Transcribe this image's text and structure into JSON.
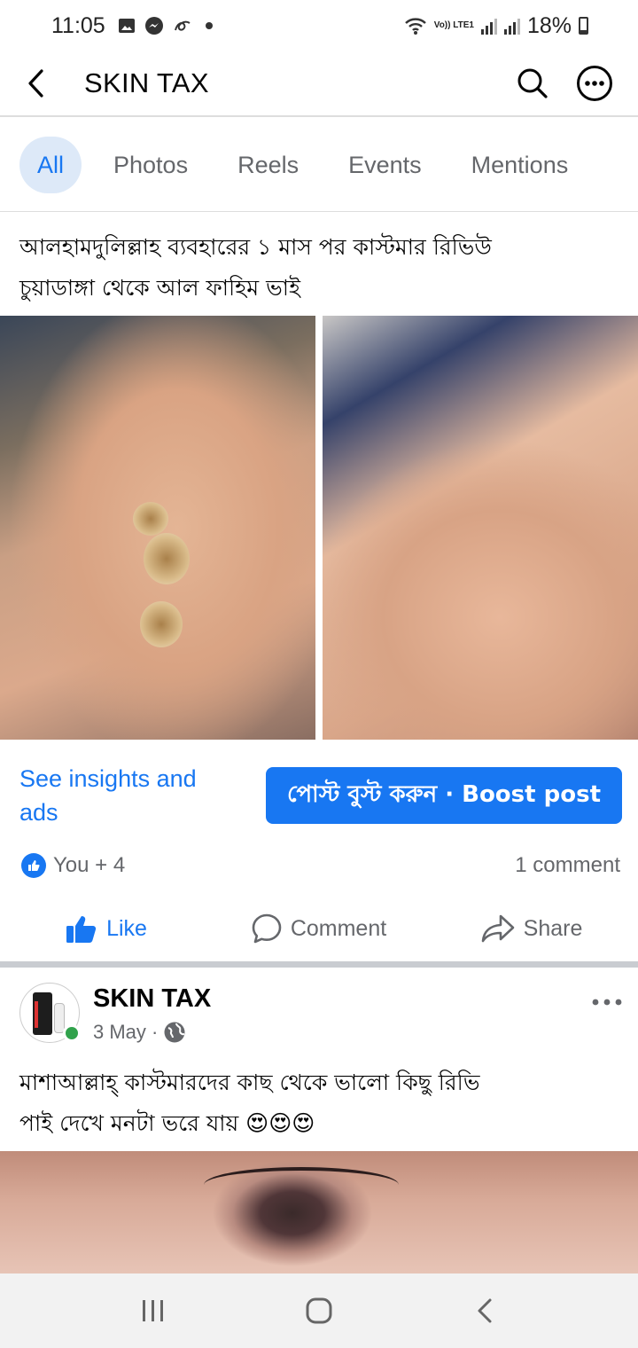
{
  "status_bar": {
    "time": "11:05",
    "network_label": "Vo)) LTE1",
    "battery": "18%"
  },
  "header": {
    "title": "SKIN TAX"
  },
  "tabs": [
    {
      "label": "All",
      "active": true
    },
    {
      "label": "Photos",
      "active": false
    },
    {
      "label": "Reels",
      "active": false
    },
    {
      "label": "Events",
      "active": false
    },
    {
      "label": "Mentions",
      "active": false
    }
  ],
  "post1": {
    "text_line1": "আলহামদুলিল্লাহ ব্যবহারের  ১ মাস পর কাস্টমার রিভিউ",
    "text_line2": "চুয়াডাঙ্গা থেকে আল ফাহিম ভাই",
    "insights_link": "See insights and ads",
    "boost_button": "পোস্ট বুস্ট করুন · Boost post",
    "reactions": "You + 4",
    "comments": "1 comment",
    "actions": {
      "like": "Like",
      "comment": "Comment",
      "share": "Share"
    }
  },
  "post2": {
    "author": "SKIN TAX",
    "date": "3 May ·",
    "text_line1": "মাশাআল্লাহ্ কাস্টমারদের কাছ থেকে ভালো কিছু রিভি",
    "text_line2": "পাই দেখে মনটা ভরে যায় 😍😍😍"
  },
  "colors": {
    "brand_blue": "#1877f2",
    "tab_active_bg": "#dde9f8",
    "secondary_text": "#65676b",
    "online_green": "#31a24c"
  }
}
